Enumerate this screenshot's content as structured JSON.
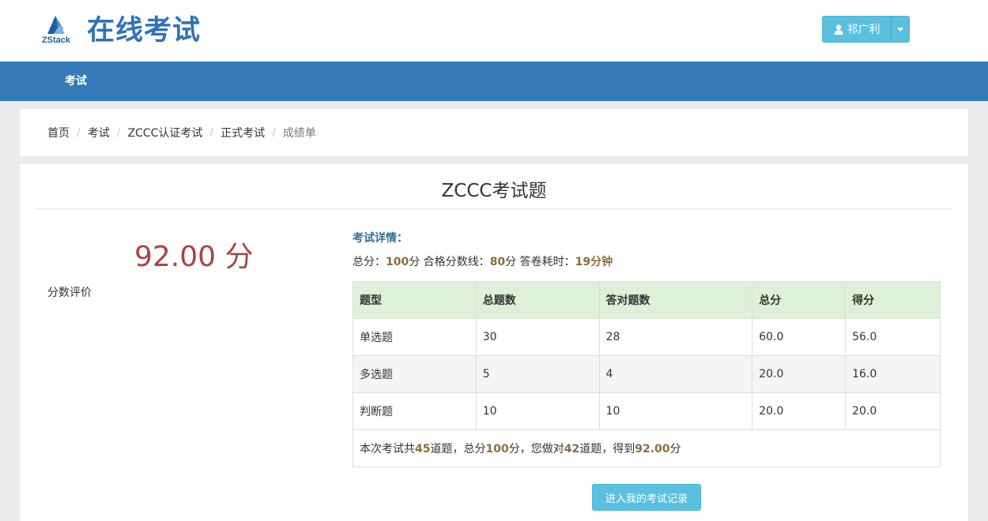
{
  "header": {
    "logo_text": "ZStack",
    "title": "在线考试",
    "user_name": "祁广利"
  },
  "nav": {
    "items": [
      {
        "label": "考试"
      }
    ]
  },
  "breadcrumb": [
    {
      "label": "首页"
    },
    {
      "label": "考试"
    },
    {
      "label": "ZCCC认证考试"
    },
    {
      "label": "正式考试"
    },
    {
      "label": "成绩单"
    }
  ],
  "breadcrumb_separator": "/",
  "exam": {
    "title": "ZCCC考试题",
    "score_display": "92.00 分",
    "score_eval_label": "分数评价",
    "details_heading": "考试详情：",
    "details": {
      "total_label": "总分：",
      "total_value": "100",
      "total_unit": "分",
      "pass_label": " 合格分数线：",
      "pass_value": "80",
      "pass_unit": "分",
      "time_label": " 答卷耗时：",
      "time_value": "19分钟"
    },
    "table": {
      "headers": [
        "题型",
        "总题数",
        "答对题数",
        "总分",
        "得分"
      ],
      "rows": [
        [
          "单选题",
          "30",
          "28",
          "60.0",
          "56.0"
        ],
        [
          "多选题",
          "5",
          "4",
          "20.0",
          "16.0"
        ],
        [
          "判断题",
          "10",
          "10",
          "20.0",
          "20.0"
        ]
      ]
    },
    "summary": {
      "p1": "本次考试共",
      "count": "45",
      "p2": "道题，总分",
      "total": "100",
      "p3": "分，您做对",
      "correct": "42",
      "p4": "道题，得到",
      "score": "92.00",
      "p5": "分"
    },
    "record_button": "进入我的考试记录"
  },
  "colors": {
    "brand_blue": "#2f72b8",
    "navbar": "#337ab7",
    "info_button": "#5bc0de",
    "score_red": "#a94442",
    "highlight": "#8a6d3b",
    "table_header": "#dff0d8"
  }
}
